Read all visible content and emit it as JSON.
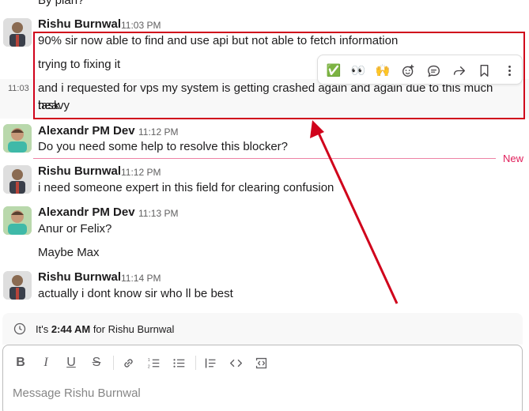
{
  "top_cut_text": "By plan?",
  "messages": [
    {
      "author": "Rishu Burnwal",
      "time": "11:03 PM",
      "lines": [
        "90% sir now able to find and use api but not able to fetch information",
        "trying to fixing it",
        "and i requested for vps my system is getting crashed again and again due to this much heavy",
        "task"
      ],
      "side_time": "11:03"
    },
    {
      "author": "Alexandr PM Dev",
      "time": "11:12 PM",
      "lines": [
        "Do you need some help to resolve this blocker?"
      ]
    },
    {
      "author": "Rishu Burnwal",
      "time": "11:12 PM",
      "lines": [
        "i need someone expert in this field for clearing confusion"
      ]
    },
    {
      "author": "Alexandr PM Dev",
      "time": "11:13 PM",
      "lines": [
        "Anur or Felix?",
        "Maybe Max"
      ]
    },
    {
      "author": "Rishu Burnwal",
      "time": "11:14 PM",
      "lines": [
        "actually i dont know sir who ll be best"
      ]
    }
  ],
  "new_label": "New",
  "toolbar": {
    "icons": [
      "check-mark-emoji-icon",
      "eyes-emoji-icon",
      "raised-hands-emoji-icon",
      "add-reaction-icon",
      "reply-thread-icon",
      "share-forward-icon",
      "bookmark-icon",
      "more-actions-icon"
    ],
    "emoji_check": "✅",
    "emoji_eyes": "👀",
    "emoji_hands": "🙌"
  },
  "status": {
    "prefix": "It's ",
    "time": "2:44 AM",
    "suffix": " for Rishu Burnwal"
  },
  "composer": {
    "placeholder": "Message Rishu Burnwal",
    "value": "",
    "format_buttons": [
      "B",
      "I",
      "U",
      "S"
    ]
  },
  "colors": {
    "annotation_red": "#d0021b",
    "new_divider": "#e01e5a"
  }
}
